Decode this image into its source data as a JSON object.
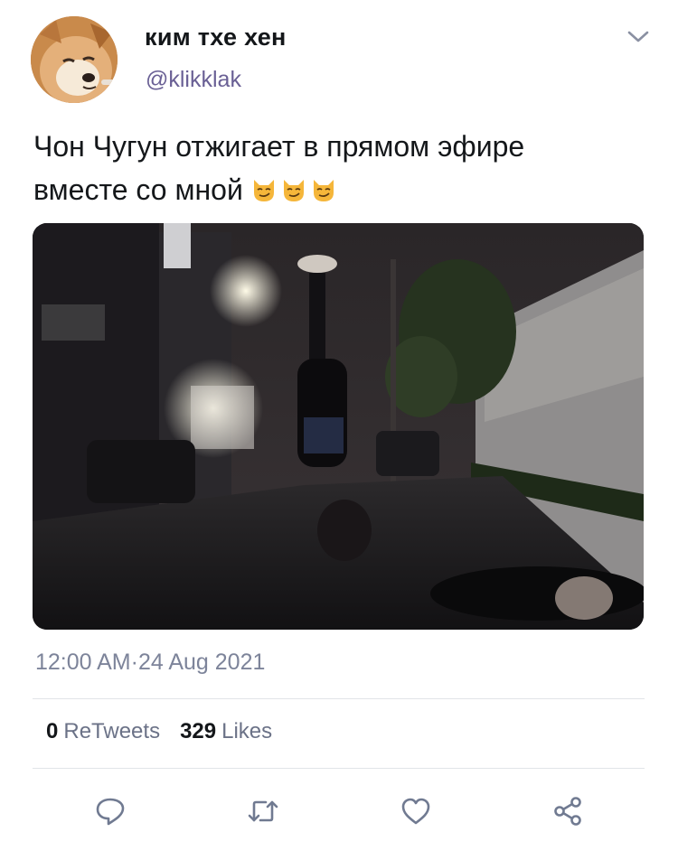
{
  "tweet": {
    "display_name": "ким тхе хен",
    "handle": "@klikklak",
    "text_line1": "Чон Чугун отжигает в прямом эфире",
    "text_line2": "вместе со мной",
    "emoji": [
      "smirking-cat",
      "smirking-cat",
      "smirking-cat"
    ],
    "timestamp": "12:00 AM·24 Aug 2021"
  },
  "stats": {
    "retweets_count": "0",
    "retweets_label": "ReTweets",
    "likes_count": "329",
    "likes_label": "Likes"
  },
  "actions": {
    "reply_icon": "reply-icon",
    "retweet_icon": "retweet-icon",
    "like_icon": "like-icon",
    "share_icon": "share-icon"
  },
  "colors": {
    "handle": "#6a6095",
    "timestamp": "#7d849a",
    "icon": "#707a91"
  }
}
